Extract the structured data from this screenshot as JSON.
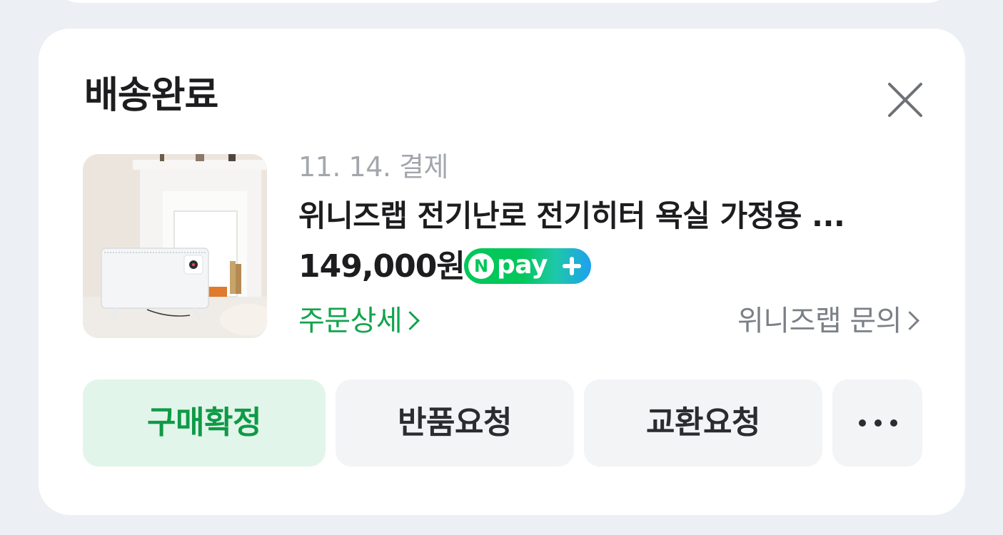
{
  "order": {
    "status": "배송완료",
    "pay_date": "11. 14. 결제",
    "product_name": "위니즈랩 전기난로 전기히터 욕실 가정용 ...",
    "price": "149,000원",
    "npay_badge": {
      "n_letter": "N",
      "word": "pay"
    },
    "links": {
      "order_detail": "주문상세",
      "seller_inquiry": "위니즈랩 문의"
    }
  },
  "actions": {
    "confirm_purchase": "구매확정",
    "return_request": "반품요청",
    "exchange_request": "교환요청"
  },
  "icons": {
    "close": "close-icon",
    "more": "more-dots-icon",
    "chevron": "chevron-right-icon"
  },
  "colors": {
    "accent_green": "#11a44c",
    "confirm_bg": "#e2f5ea",
    "page_bg": "#eceff4",
    "card_bg": "#ffffff"
  }
}
